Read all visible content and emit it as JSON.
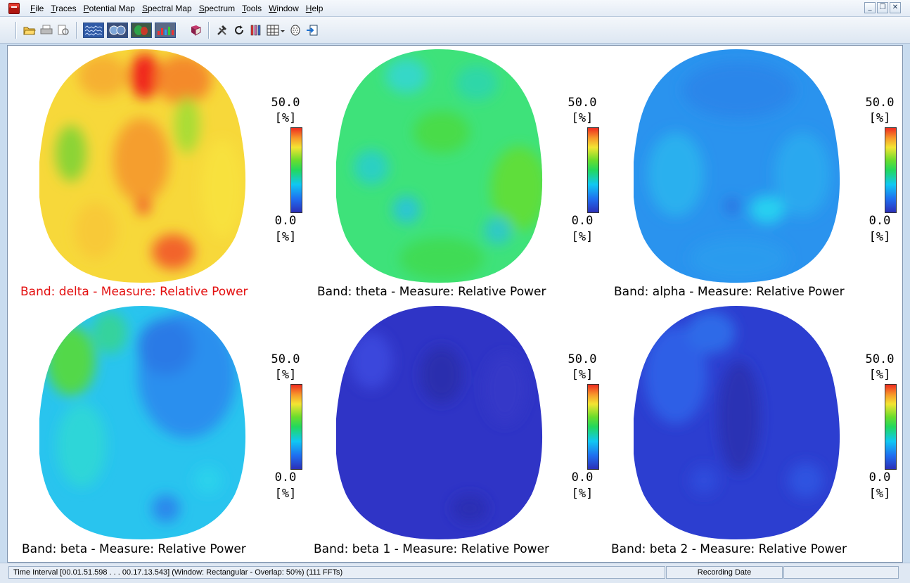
{
  "menu": {
    "items": [
      "File",
      "Traces",
      "Potential Map",
      "Spectral Map",
      "Spectrum",
      "Tools",
      "Window",
      "Help"
    ]
  },
  "window_controls": [
    "minimize",
    "restore",
    "close"
  ],
  "toolbar": {
    "buttons": [
      {
        "icon": "open-folder-icon"
      },
      {
        "icon": "print-icon"
      },
      {
        "icon": "print-preview-icon"
      },
      {
        "icon": "traces-view-icon"
      },
      {
        "icon": "potential-map-view-icon"
      },
      {
        "icon": "spectral-map-view-icon"
      },
      {
        "icon": "spectrum-view-icon"
      },
      {
        "icon": "book-icon"
      },
      {
        "icon": "tools-icon"
      },
      {
        "icon": "refresh-icon"
      },
      {
        "icon": "colorbars-icon"
      },
      {
        "icon": "grid-layout-icon"
      },
      {
        "icon": "head-electrodes-icon"
      },
      {
        "icon": "export-icon"
      }
    ]
  },
  "maps": [
    {
      "caption": "Band: delta - Measure: Relative Power",
      "active": true,
      "max_label": "50.0",
      "unit": "[%]",
      "min_label": "0.0",
      "base_color": "#f7d83a"
    },
    {
      "caption": "Band: theta - Measure: Relative Power",
      "active": false,
      "max_label": "50.0",
      "unit": "[%]",
      "min_label": "0.0",
      "base_color": "#3ee27a"
    },
    {
      "caption": "Band: alpha - Measure: Relative Power",
      "active": false,
      "max_label": "50.0",
      "unit": "[%]",
      "min_label": "0.0",
      "base_color": "#2a93ee"
    },
    {
      "caption": "Band: beta - Measure: Relative Power",
      "active": false,
      "max_label": "50.0",
      "unit": "[%]",
      "min_label": "0.0",
      "base_color": "#29c4ee"
    },
    {
      "caption": "Band: beta 1 - Measure: Relative Power",
      "active": false,
      "max_label": "50.0",
      "unit": "[%]",
      "min_label": "0.0",
      "base_color": "#2f34c6"
    },
    {
      "caption": "Band: beta 2 - Measure: Relative Power",
      "active": false,
      "max_label": "50.0",
      "unit": "[%]",
      "min_label": "0.0",
      "base_color": "#2c3ed0"
    }
  ],
  "status": {
    "interval": "Time Interval [00.01.51.598 . . . 00.17.13.543] (Window: Rectangular - Overlap: 50%) (111 FFTs)",
    "recording_date_label": "Recording Date",
    "extra": ""
  },
  "colors": {
    "active_caption": "#e31010",
    "colorbar_top": "#ee2c20",
    "colorbar_bottom": "#2c2fb8"
  }
}
